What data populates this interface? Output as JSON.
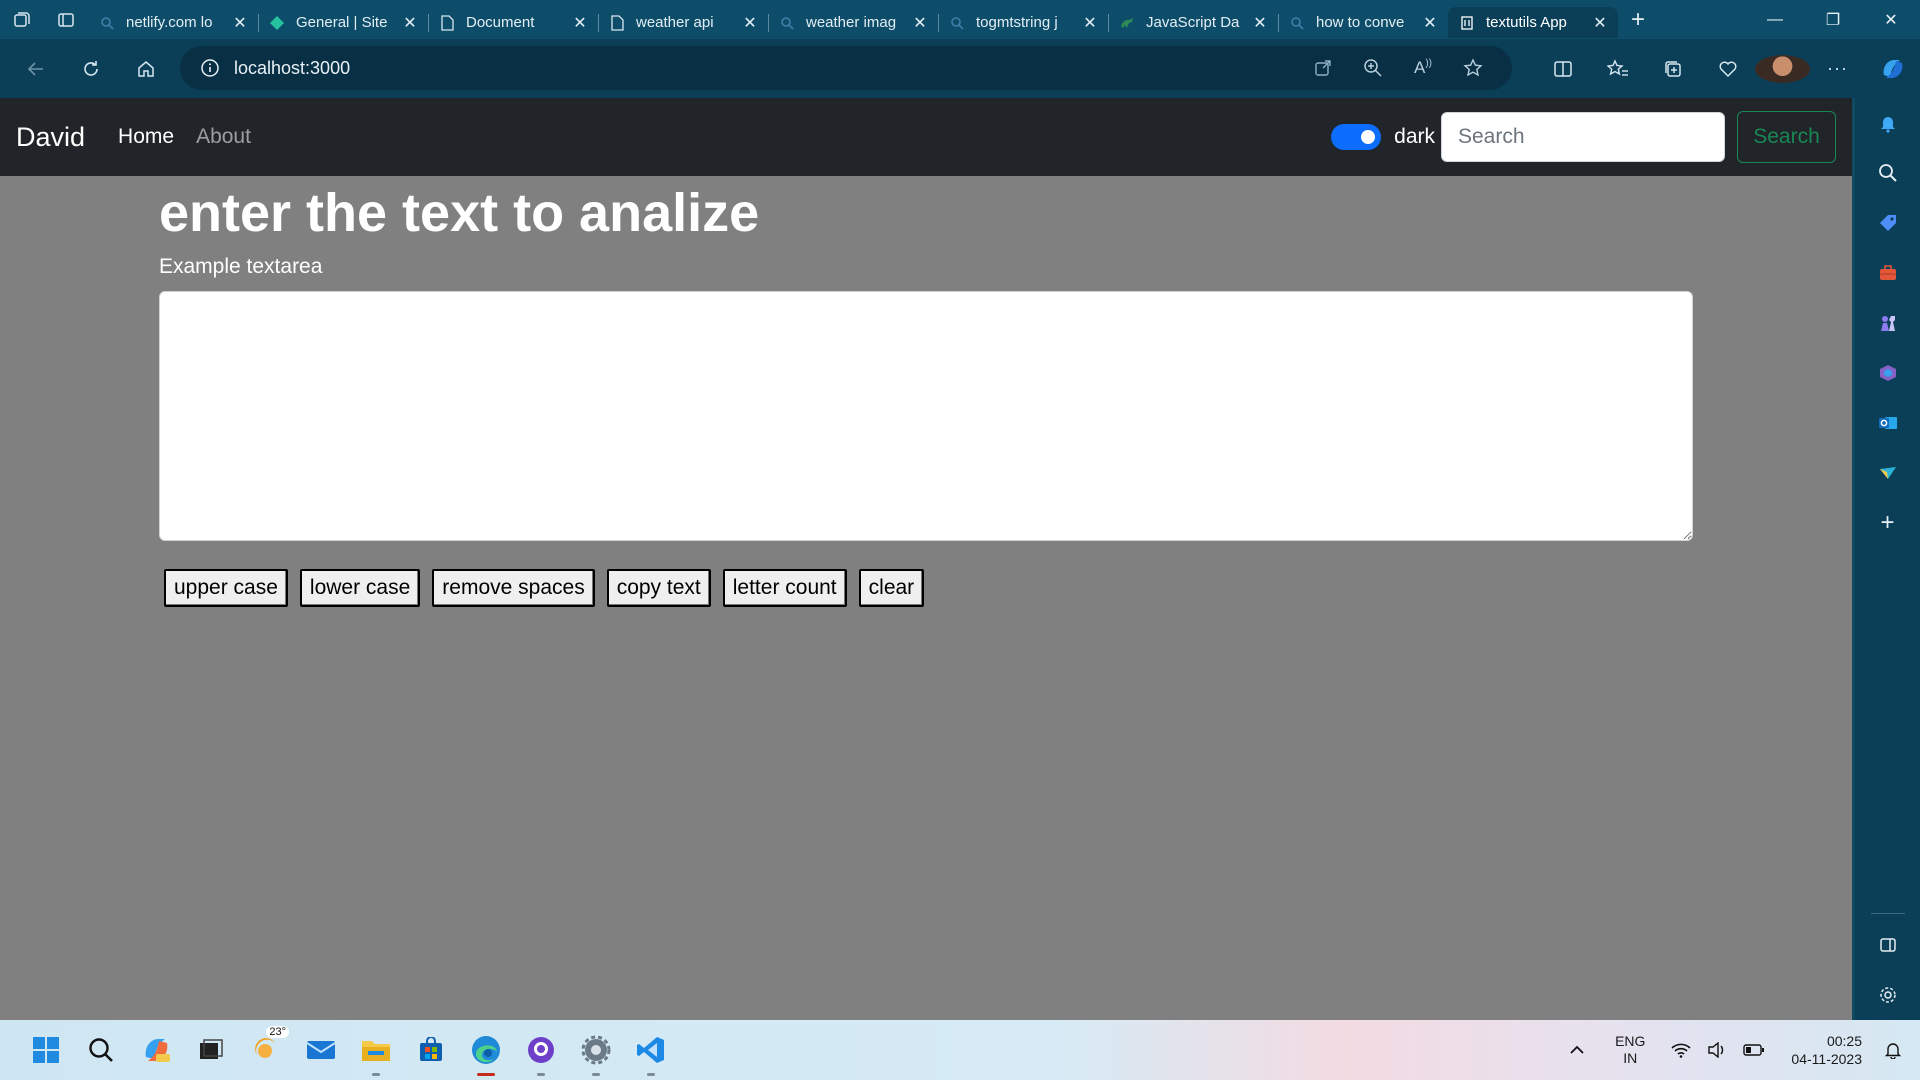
{
  "browser": {
    "tabs": [
      {
        "title": "netlify.com lo",
        "icon": "search-icon",
        "active": false
      },
      {
        "title": "General | Site",
        "icon": "netlify-diamond-icon",
        "active": false
      },
      {
        "title": "Document",
        "icon": "page-icon",
        "active": false
      },
      {
        "title": "weather api",
        "icon": "page-icon",
        "active": false
      },
      {
        "title": "weather imag",
        "icon": "search-icon",
        "active": false
      },
      {
        "title": "togmtstring j",
        "icon": "search-icon",
        "active": false
      },
      {
        "title": "JavaScript Da",
        "icon": "dinosaur-icon",
        "active": false
      },
      {
        "title": "how to conve",
        "icon": "search-icon",
        "active": false
      },
      {
        "title": "textutils App",
        "icon": "react-app-icon",
        "active": true
      }
    ],
    "url": "localhost:3000"
  },
  "app": {
    "brand": "David",
    "nav": {
      "home": "Home",
      "about": "About"
    },
    "dark_label": "dark",
    "dark_mode_on": true,
    "search_placeholder": "Search",
    "search_button": "Search",
    "heading": "enter the text to analize",
    "textarea_label": "Example textarea",
    "textarea_value": "",
    "buttons": {
      "upper": "upper case",
      "lower": "lower case",
      "remove_spaces": "remove spaces",
      "copy": "copy text",
      "count": "letter count",
      "clear": "clear"
    }
  },
  "colors": {
    "page_bg": "#808080",
    "navbar_bg": "#212529",
    "switch_on": "#0d6efd",
    "search_outline": "#198754"
  },
  "taskbar": {
    "weather_temp": "23°",
    "lang_top": "ENG",
    "lang_bottom": "IN",
    "time": "00:25",
    "date": "04-11-2023"
  }
}
